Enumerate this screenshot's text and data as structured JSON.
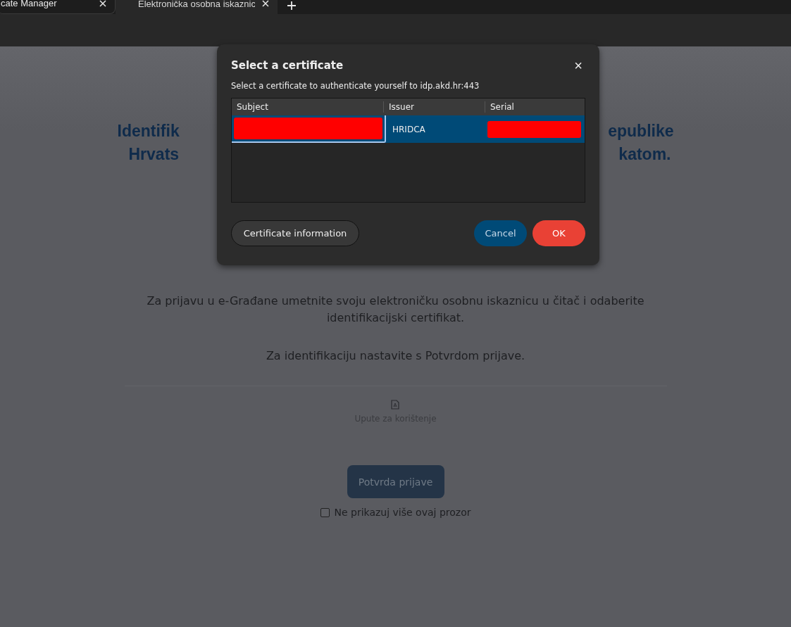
{
  "browser": {
    "tabs": [
      {
        "label": "cate Manager",
        "selected": false
      },
      {
        "label": "Elektronička osobna iskaznic",
        "selected": true
      }
    ]
  },
  "page": {
    "heading_lines": [
      {
        "left": "Identifik",
        "right": "epublike"
      },
      {
        "left": "Hrvats",
        "right": "katom."
      }
    ],
    "instructions": "Za prijavu u e-Građane umetnite svoju elektroničku osobnu iskaznicu u čitač i odaberite identifikacijski certifikat.",
    "continue_note": "Za identifikaciju nastavite s Potvrdom prijave.",
    "manual_link": "Upute za korištenje",
    "confirm_button": "Potvrda prijave",
    "dont_show_checkbox": {
      "label": "Ne prikazuj više ovaj prozor",
      "checked": false
    }
  },
  "dialog": {
    "title": "Select a certificate",
    "close": "×",
    "message": "Select a certificate to authenticate yourself to idp.akd.hr:443",
    "table": {
      "columns": [
        "Subject",
        "Issuer",
        "Serial"
      ],
      "rows": [
        {
          "issuer": "HRIDCA",
          "selected": true
        }
      ]
    },
    "buttons": {
      "info": "Certificate information",
      "cancel": "Cancel",
      "ok": "OK"
    }
  }
}
